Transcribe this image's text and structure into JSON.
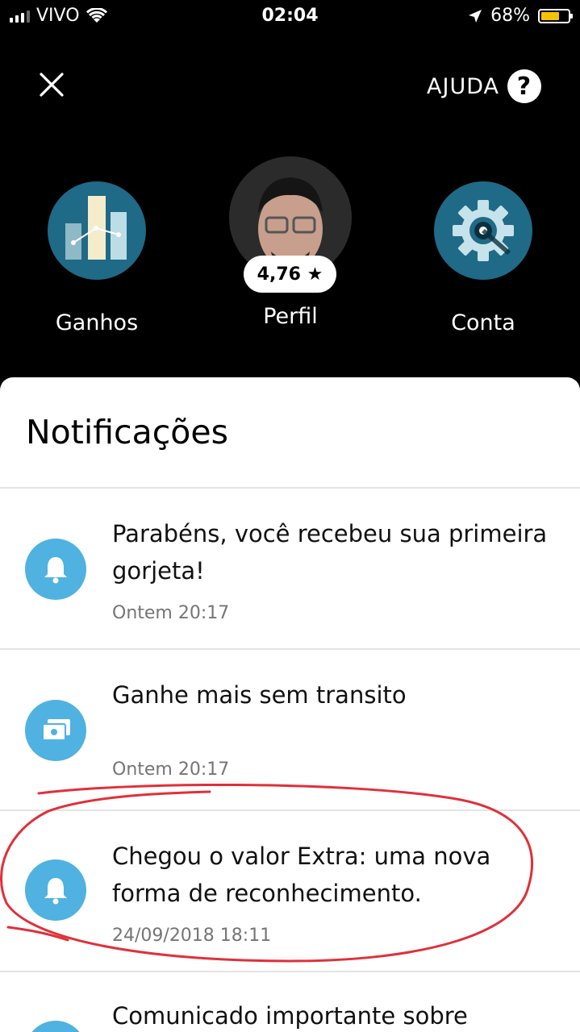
{
  "status": {
    "carrier": "VIVO",
    "time": "02:04",
    "battery": "68%",
    "battery_level": 0.68
  },
  "header": {
    "help_label": "AJUDA",
    "help_icon_glyph": "?"
  },
  "tiles": [
    {
      "label": "Ganhos",
      "icon": "chart-icon"
    },
    {
      "label": "Perfil",
      "icon": "avatar"
    },
    {
      "label": "Conta",
      "icon": "gear-icon"
    }
  ],
  "rating": "4,76 ★",
  "notifications": {
    "title": "Notificações",
    "items": [
      {
        "title": "Parabéns, você recebeu sua primeira gorjeta!",
        "time": "Ontem 20:17",
        "icon": "bell-icon"
      },
      {
        "title": "Ganhe mais sem transito",
        "time": "Ontem 20:17",
        "icon": "money-icon"
      },
      {
        "title": "Chegou o valor Extra: uma nova forma de reconhecimento.",
        "time": "24/09/2018 18:11",
        "icon": "bell-icon"
      },
      {
        "title": "Comunicado importante sobre",
        "time": "",
        "icon": "bell-icon"
      }
    ]
  },
  "colors": {
    "accent": "#4fb2e0",
    "tile_bg": "#1f6a86",
    "annotation": "#e0303a"
  }
}
